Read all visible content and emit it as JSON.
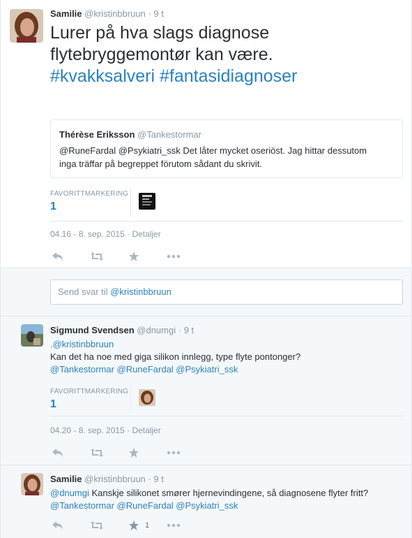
{
  "main_tweet": {
    "author_name": "Samilie",
    "author_handle": "@kristinbbruun",
    "time": "9 t",
    "text_line1": "Lurer på hva slags diagnose",
    "text_line2": "flytebryggemontør kan være.",
    "hashtag1": "#kvakksalveri",
    "hashtag2": "#fantasidiagnoser",
    "quote": {
      "author_name": "Thérèse Eriksson",
      "author_handle": "@Tankestormar",
      "text_line1": "@RuneFardal @Psykiatri_ssk Det låter mycket oseriöst. Jag hittar dessutom",
      "text_line2": "inga träffar på begreppet förutom sådant du skrivit."
    },
    "fav_label": "FAVORITTMARKERING",
    "fav_count": "1",
    "timestamp": "04.16 - 8. sep. 2015",
    "details": "Detaljer"
  },
  "reply_box": {
    "placeholder": "Send svar til",
    "mention": "@kristinbbruun"
  },
  "reply1": {
    "author_name": "Sigmund Svendsen",
    "author_handle": "@dnumgi",
    "time": "9 t",
    "mention_line": ".@kristinbbruun",
    "text": "Kan det ha noe med giga silikon innlegg, type flyte pontonger?",
    "mentions": "@Tankestormar @RuneFardal @Psykiatri_ssk",
    "fav_label": "FAVORITTMARKERING",
    "fav_count": "1",
    "timestamp": "04.20 - 8. sep. 2015",
    "details": "Detaljer"
  },
  "reply2": {
    "author_name": "Samilie",
    "author_handle": "@kristinbbruun",
    "time": "9 t",
    "mention": "@dnumgi",
    "text": "Kanskje silikonet smører hjernevindingene, så diagnosene flyter fritt?",
    "mentions": "@Tankestormar @RuneFardal @Psykiatri_ssk",
    "fav_count": "1"
  },
  "colors": {
    "link": "#2a82c0",
    "muted": "#8899a6",
    "border": "#e1e8ed",
    "reply_bg": "#f5f8fa"
  }
}
